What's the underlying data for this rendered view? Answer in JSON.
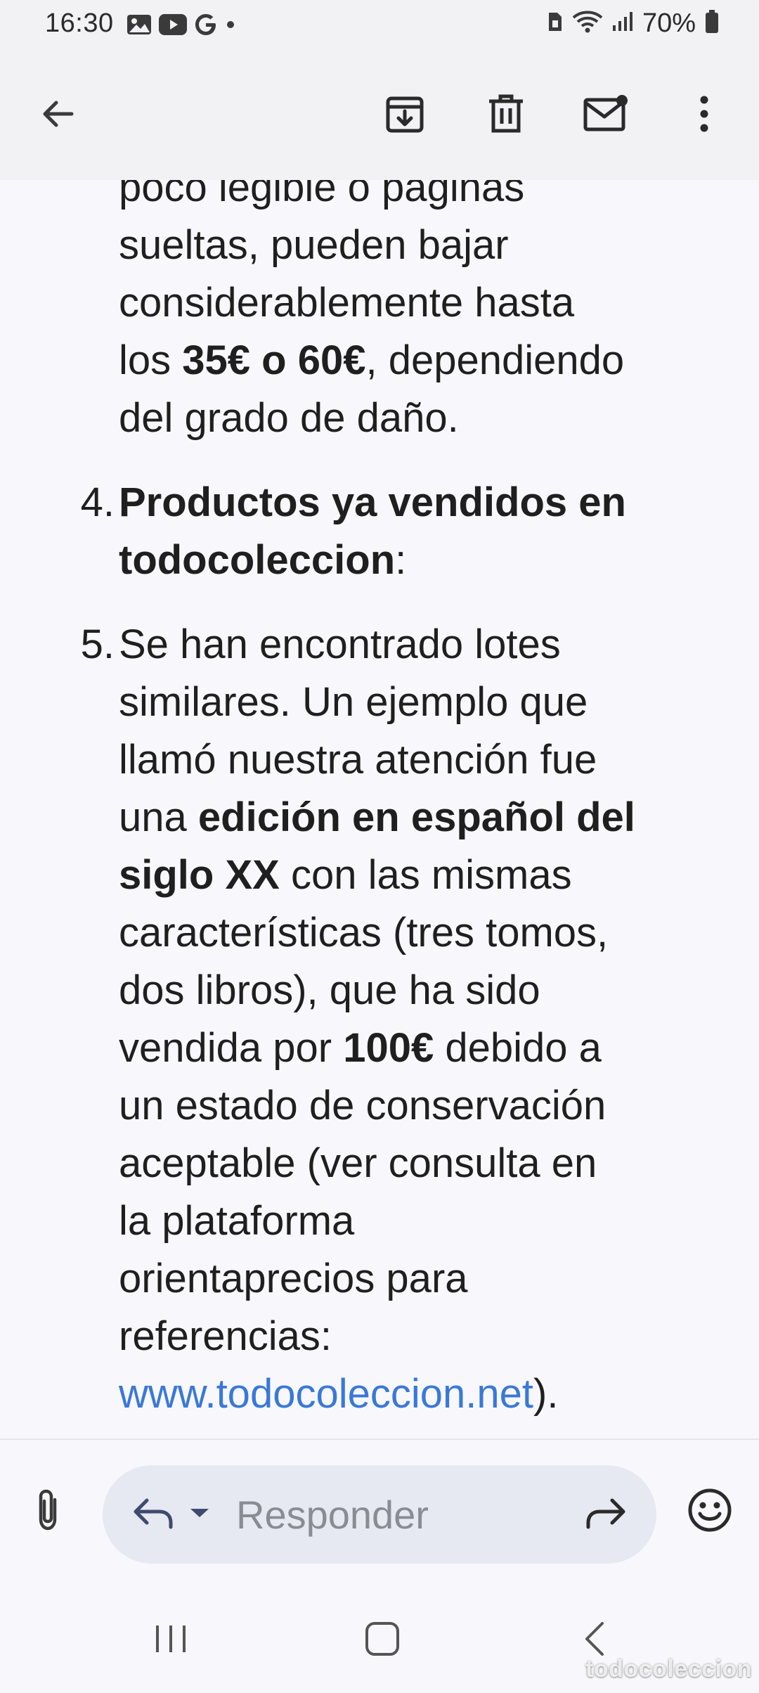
{
  "status_bar": {
    "time": "16:30",
    "battery_percent": "70%",
    "icons_left": [
      "gallery-icon",
      "youtube-icon",
      "google-icon",
      "dot-icon"
    ],
    "icons_right": [
      "sim-icon",
      "wifi-icon",
      "signal-icon",
      "battery-icon"
    ]
  },
  "app_bar": {
    "icons": [
      "back-arrow-icon",
      "archive-icon",
      "delete-icon",
      "mark-unread-icon",
      "more-vert-icon"
    ]
  },
  "message": {
    "item3": {
      "line1": "poco legible o páginas",
      "line2": "sueltas, pueden bajar",
      "line3": "considerablemente hasta",
      "line4_a": "los ",
      "line4_b": "35€ o 60€",
      "line4_c": ", dependiendo",
      "line5": "del grado de daño."
    },
    "item4": {
      "number": "4.",
      "line1": "Productos ya vendidos en",
      "line2_bold": "todocoleccion",
      "line2_rest": ":"
    },
    "item5": {
      "number": "5.",
      "line1": "Se han encontrado lotes",
      "line2": "similares. Un ejemplo que",
      "line3": "llamó nuestra atención fue",
      "line4_a": "una ",
      "line4_b": "edición en español del",
      "line5_a": "siglo XX",
      "line5_b": " con las mismas",
      "line6": "características (tres tomos,",
      "line7": "dos libros), que ha sido",
      "line8_a": "vendida por ",
      "line8_b": "100€",
      "line8_c": " debido a",
      "line9": "un estado de conservación",
      "line10": "aceptable (ver consulta en",
      "line11": "la plataforma",
      "line12": "orientaprecios para",
      "line13": "referencias:",
      "line14_link": "www.todocoleccion.net",
      "line14_rest": ")."
    }
  },
  "reply_bar": {
    "placeholder": "Responder",
    "icons": [
      "attach-icon",
      "reply-icon",
      "caret-down-icon",
      "forward-icon",
      "emoji-icon"
    ]
  },
  "nav_bar": {
    "icons": [
      "recents-icon",
      "home-icon",
      "back-icon"
    ]
  },
  "watermark": "todocoleccion",
  "colors": {
    "background": "#f8f8fc",
    "app_bar": "#f2f2f4",
    "text": "#1f1f1f",
    "link": "#3a78d8",
    "reply_pill": "#e6e8f2",
    "placeholder": "#8a8c94"
  }
}
